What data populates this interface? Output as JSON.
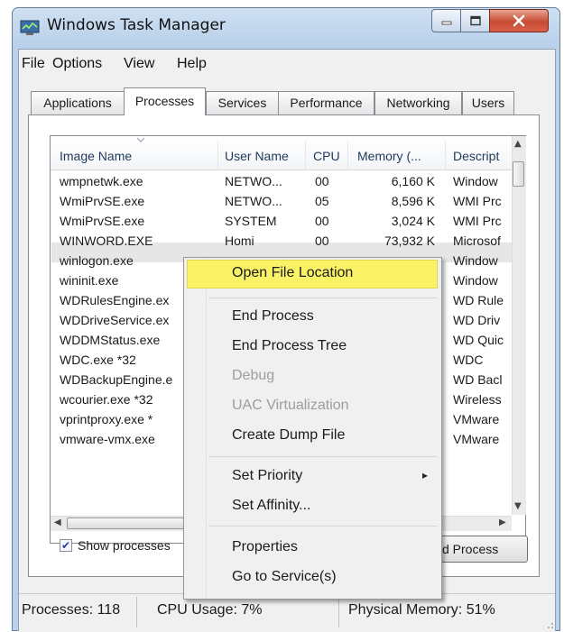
{
  "window": {
    "title": "Windows Task Manager"
  },
  "menubar": {
    "items": [
      "File",
      "Options",
      "View",
      "Help"
    ]
  },
  "tabs": [
    "Applications",
    "Processes",
    "Services",
    "Performance",
    "Networking",
    "Users"
  ],
  "active_tab": "Processes",
  "table": {
    "columns": [
      "Image Name",
      "User Name",
      "CPU",
      "Memory (...",
      "Descript"
    ],
    "rows": [
      {
        "image": "wmpnetwk.exe",
        "user": "NETWO...",
        "cpu": "00",
        "memory": "6,160 K",
        "desc": "Window"
      },
      {
        "image": "WmiPrvSE.exe",
        "user": "NETWO...",
        "cpu": "05",
        "memory": "8,596 K",
        "desc": "WMI Prc"
      },
      {
        "image": "WmiPrvSE.exe",
        "user": "SYSTEM",
        "cpu": "00",
        "memory": "3,024 K",
        "desc": "WMI Prc"
      },
      {
        "image": "WINWORD.EXE",
        "user": "Homi",
        "cpu": "00",
        "memory": "73,932 K",
        "desc": "Microsof"
      },
      {
        "image": "winlogon.exe",
        "user": "",
        "cpu": "",
        "memory": "",
        "desc": "Window"
      },
      {
        "image": "wininit.exe",
        "user": "",
        "cpu": "",
        "memory": "",
        "desc": "Window"
      },
      {
        "image": "WDRulesEngine.ex",
        "user": "",
        "cpu": "",
        "memory": "",
        "desc": "WD Rule"
      },
      {
        "image": "WDDriveService.ex",
        "user": "",
        "cpu": "",
        "memory": "",
        "desc": "WD Driv"
      },
      {
        "image": "WDDMStatus.exe",
        "user": "",
        "cpu": "",
        "memory": "",
        "desc": "WD Quic"
      },
      {
        "image": "WDC.exe *32",
        "user": "",
        "cpu": "",
        "memory": "",
        "desc": "WDC"
      },
      {
        "image": "WDBackupEngine.e",
        "user": "",
        "cpu": "",
        "memory": "",
        "desc": "WD Bacl"
      },
      {
        "image": "wcourier.exe *32",
        "user": "",
        "cpu": "",
        "memory": "",
        "desc": "Wireless"
      },
      {
        "image": "vprintproxy.exe *",
        "user": "",
        "cpu": "",
        "memory": "",
        "desc": "VMware"
      },
      {
        "image": "vmware-vmx.exe",
        "user": "",
        "cpu": "",
        "memory": "",
        "desc": "VMware"
      }
    ]
  },
  "controls": {
    "show_processes_label": "Show processes",
    "end_process_label": "d Process"
  },
  "context_menu": {
    "items": [
      {
        "label": "Open File Location",
        "state": "highlighted"
      },
      {
        "label": "End Process",
        "state": "enabled"
      },
      {
        "label": "End Process Tree",
        "state": "enabled"
      },
      {
        "label": "Debug",
        "state": "disabled"
      },
      {
        "label": "UAC Virtualization",
        "state": "disabled"
      },
      {
        "label": "Create Dump File",
        "state": "enabled"
      },
      {
        "label": "Set Priority",
        "state": "enabled",
        "submenu": "▸"
      },
      {
        "label": "Set Affinity...",
        "state": "enabled"
      },
      {
        "label": "Properties",
        "state": "enabled"
      },
      {
        "label": "Go to Service(s)",
        "state": "enabled"
      }
    ]
  },
  "statusbar": {
    "processes": "Processes: 118",
    "cpu": "CPU Usage: 7%",
    "memory": "Physical Memory: 51%"
  },
  "colors": {
    "highlight": "#fbf367",
    "close_button": "#c74a32",
    "title_bar": "#b9d1ea"
  }
}
